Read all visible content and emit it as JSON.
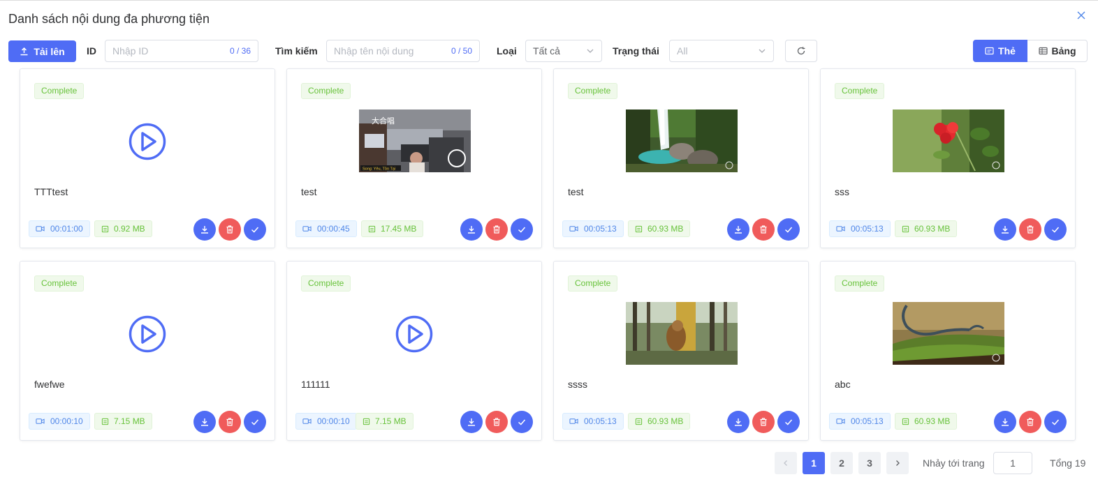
{
  "dialog": {
    "title": "Danh sách nội dung đa phương tiện"
  },
  "toolbar": {
    "upload_label": "Tải lên",
    "id_label": "ID",
    "id_placeholder": "Nhập ID",
    "id_count": "0 / 36",
    "search_label": "Tìm kiếm",
    "search_placeholder": "Nhập tên nội dung",
    "search_count": "0 / 50",
    "type_label": "Loại",
    "type_value": "Tất cả",
    "status_label": "Trạng thái",
    "status_value": "All",
    "view_card_label": "Thẻ",
    "view_table_label": "Bảng"
  },
  "items": [
    {
      "status": "Complete",
      "name": "TTTtest",
      "duration": "00:01:00",
      "size": "0.92 MB",
      "thumbnail": "play-icon"
    },
    {
      "status": "Complete",
      "name": "test",
      "duration": "00:00:45",
      "size": "17.45 MB",
      "thumbnail": "office-photo"
    },
    {
      "status": "Complete",
      "name": "test",
      "duration": "00:05:13",
      "size": "60.93 MB",
      "thumbnail": "waterfall-photo"
    },
    {
      "status": "Complete",
      "name": "sss",
      "duration": "00:05:13",
      "size": "60.93 MB",
      "thumbnail": "red-flower-photo"
    },
    {
      "status": "Complete",
      "name": "fwefwe",
      "duration": "00:00:10",
      "size": "7.15 MB",
      "thumbnail": "play-icon"
    },
    {
      "status": "Complete",
      "name": "111111",
      "duration": "00:00:10",
      "size": "7.15 MB",
      "thumbnail": "play-icon"
    },
    {
      "status": "Complete",
      "name": "ssss",
      "duration": "00:05:13",
      "size": "60.93 MB",
      "thumbnail": "sloth-photo"
    },
    {
      "status": "Complete",
      "name": "abc",
      "duration": "00:05:13",
      "size": "60.93 MB",
      "thumbnail": "lizard-photo"
    }
  ],
  "pagination": {
    "pages": [
      "1",
      "2",
      "3"
    ],
    "current": "1",
    "jump_label": "Nhảy tới trang",
    "jump_value": "1",
    "total": "Tổng 19"
  },
  "colors": {
    "primary": "#4f6cf5",
    "danger": "#f05b5b",
    "success": "#67c23a"
  }
}
